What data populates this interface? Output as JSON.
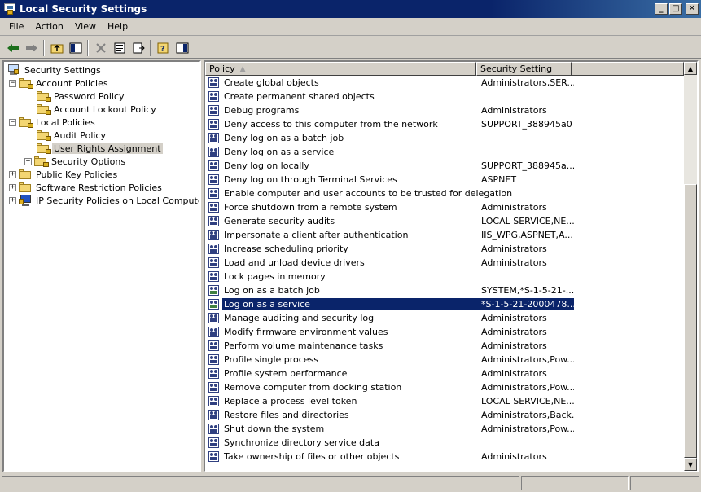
{
  "window": {
    "title": "Local Security Settings",
    "minimize": "_",
    "maximize": "□",
    "close": "✕"
  },
  "menu": {
    "items": [
      {
        "label": "File"
      },
      {
        "label": "Action"
      },
      {
        "label": "View"
      },
      {
        "label": "Help"
      }
    ]
  },
  "toolbar": {
    "buttons": [
      "back-icon",
      "forward-icon",
      "up-folder-icon",
      "show-hide-tree-icon",
      "delete-icon",
      "properties-icon",
      "export-list-icon",
      "help-icon",
      "show-console-icon"
    ]
  },
  "tree": {
    "root": "Security Settings",
    "nodes": [
      {
        "label": "Account Policies",
        "expander": "−"
      },
      {
        "label": "Password Policy"
      },
      {
        "label": "Account Lockout Policy"
      },
      {
        "label": "Local Policies",
        "expander": "−"
      },
      {
        "label": "Audit Policy"
      },
      {
        "label": "User Rights Assignment"
      },
      {
        "label": "Security Options",
        "expander": "+"
      },
      {
        "label": "Public Key Policies",
        "expander": "+"
      },
      {
        "label": "Software Restriction Policies",
        "expander": "+"
      },
      {
        "label": "IP Security Policies on Local Computer",
        "expander": "+"
      }
    ]
  },
  "list": {
    "columns": [
      {
        "label": "Policy",
        "sort": "▲"
      },
      {
        "label": "Security Setting"
      }
    ],
    "rows": [
      {
        "policy": "Create global objects",
        "setting": "Administrators,SER..."
      },
      {
        "policy": "Create permanent shared objects",
        "setting": ""
      },
      {
        "policy": "Debug programs",
        "setting": "Administrators"
      },
      {
        "policy": "Deny access to this computer from the network",
        "setting": "SUPPORT_388945a0"
      },
      {
        "policy": "Deny log on as a batch job",
        "setting": ""
      },
      {
        "policy": "Deny log on as a service",
        "setting": ""
      },
      {
        "policy": "Deny log on locally",
        "setting": "SUPPORT_388945a..."
      },
      {
        "policy": "Deny log on through Terminal Services",
        "setting": "ASPNET"
      },
      {
        "policy": "Enable computer and user accounts to be trusted for delegation",
        "setting": ""
      },
      {
        "policy": "Force shutdown from a remote system",
        "setting": "Administrators"
      },
      {
        "policy": "Generate security audits",
        "setting": "LOCAL SERVICE,NE..."
      },
      {
        "policy": "Impersonate a client after authentication",
        "setting": "IIS_WPG,ASPNET,A..."
      },
      {
        "policy": "Increase scheduling priority",
        "setting": "Administrators"
      },
      {
        "policy": "Load and unload device drivers",
        "setting": "Administrators"
      },
      {
        "policy": "Lock pages in memory",
        "setting": ""
      },
      {
        "policy": "Log on as a batch job",
        "setting": "SYSTEM,*S-1-5-21-..."
      },
      {
        "policy": "Log on as a service",
        "setting": "*S-1-5-21-2000478..."
      },
      {
        "policy": "Manage auditing and security log",
        "setting": "Administrators"
      },
      {
        "policy": "Modify firmware environment values",
        "setting": "Administrators"
      },
      {
        "policy": "Perform volume maintenance tasks",
        "setting": "Administrators"
      },
      {
        "policy": "Profile single process",
        "setting": "Administrators,Pow..."
      },
      {
        "policy": "Profile system performance",
        "setting": "Administrators"
      },
      {
        "policy": "Remove computer from docking station",
        "setting": "Administrators,Pow..."
      },
      {
        "policy": "Replace a process level token",
        "setting": "LOCAL SERVICE,NE..."
      },
      {
        "policy": "Restore files and directories",
        "setting": "Administrators,Back..."
      },
      {
        "policy": "Shut down the system",
        "setting": "Administrators,Pow..."
      },
      {
        "policy": "Synchronize directory service data",
        "setting": ""
      },
      {
        "policy": "Take ownership of files or other objects",
        "setting": "Administrators"
      }
    ]
  },
  "scrollbar": {
    "up": "▲",
    "down": "▼"
  }
}
